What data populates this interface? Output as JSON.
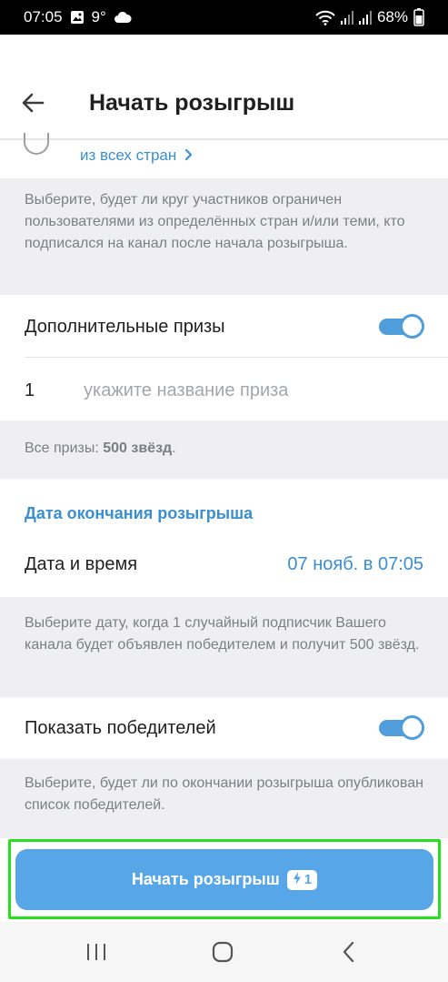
{
  "status_bar": {
    "time": "07:05",
    "temperature": "9°",
    "battery": "68%",
    "icons": [
      "image-icon",
      "cloud-icon",
      "wifi-icon",
      "signal-icon",
      "signal-icon",
      "battery-icon"
    ]
  },
  "header": {
    "title": "Начать розыгрыш",
    "back_icon": "arrow-left-icon"
  },
  "countries": {
    "link_text": "из всех стран",
    "link_icon": "chevron-right-icon",
    "hint": "Выберите, будет ли круг участников ограничен пользователями из определённых стран и/или теми, кто подписался на канал после начала розыгрыша."
  },
  "extra_prizes": {
    "label": "Дополнительные призы",
    "toggle_on": true,
    "prize_number": "1",
    "prize_placeholder": "укажите название приза",
    "summary_prefix": "Все призы:",
    "summary_value": "500 звёзд",
    "summary_suffix": "."
  },
  "end_date": {
    "section_title": "Дата окончания розыгрыша",
    "label": "Дата и время",
    "value": "07 нояб. в 07:05",
    "hint": "Выберите дату, когда 1 случайный подписчик Вашего канала будет объявлен победителем и получит 500 звёзд."
  },
  "show_winners": {
    "label": "Показать победителей",
    "toggle_on": true,
    "hint": "Выберите, будет ли по окончании розыгрыша опубликован список победителей."
  },
  "cta": {
    "label": "Начать розыгрыш",
    "badge_icon": "lightning-icon",
    "badge_count": "1"
  },
  "colors": {
    "accent": "#3a8fd0",
    "button": "#57a6e8",
    "highlight": "#25e01c",
    "section_bg": "#efeff3"
  },
  "nav_bar": {
    "icons": [
      "recent-apps-icon",
      "home-icon",
      "back-icon"
    ]
  }
}
